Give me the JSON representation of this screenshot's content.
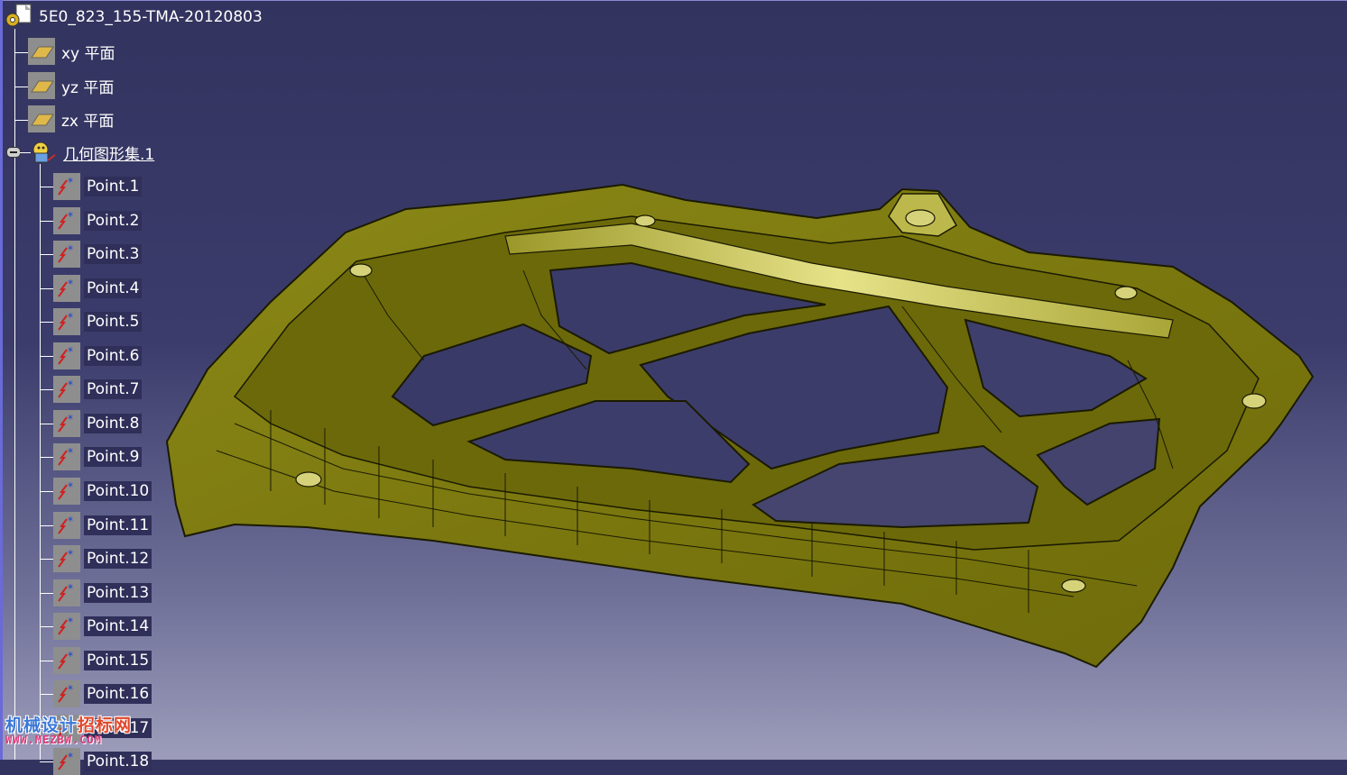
{
  "root": {
    "label": "5E0_823_155-TMA-20120803",
    "icon": "product-gear-icon"
  },
  "planes": [
    {
      "label": "xy 平面",
      "icon": "plane-icon"
    },
    {
      "label": "yz 平面",
      "icon": "plane-icon"
    },
    {
      "label": "zx 平面",
      "icon": "plane-icon"
    }
  ],
  "geoset": {
    "label": "几何图形集.1",
    "icon": "geometrical-set-icon",
    "expanded": true
  },
  "points": [
    {
      "label": "Point.1"
    },
    {
      "label": "Point.2"
    },
    {
      "label": "Point.3"
    },
    {
      "label": "Point.4"
    },
    {
      "label": "Point.5"
    },
    {
      "label": "Point.6"
    },
    {
      "label": "Point.7"
    },
    {
      "label": "Point.8"
    },
    {
      "label": "Point.9"
    },
    {
      "label": "Point.10"
    },
    {
      "label": "Point.11"
    },
    {
      "label": "Point.12"
    },
    {
      "label": "Point.13"
    },
    {
      "label": "Point.14"
    },
    {
      "label": "Point.15"
    },
    {
      "label": "Point.16"
    },
    {
      "label": "Point.17"
    },
    {
      "label": "Point.18"
    }
  ],
  "watermark": {
    "line1_a": "机械设计",
    "line1_b": "招标网",
    "line2": "WWW.MEZBW.COM"
  },
  "colors": {
    "part_fill": "#807d12",
    "part_light": "#d8d46a",
    "part_edge": "#1a1a00",
    "background_top": "#33335f",
    "background_bottom": "#9d9dbb"
  }
}
